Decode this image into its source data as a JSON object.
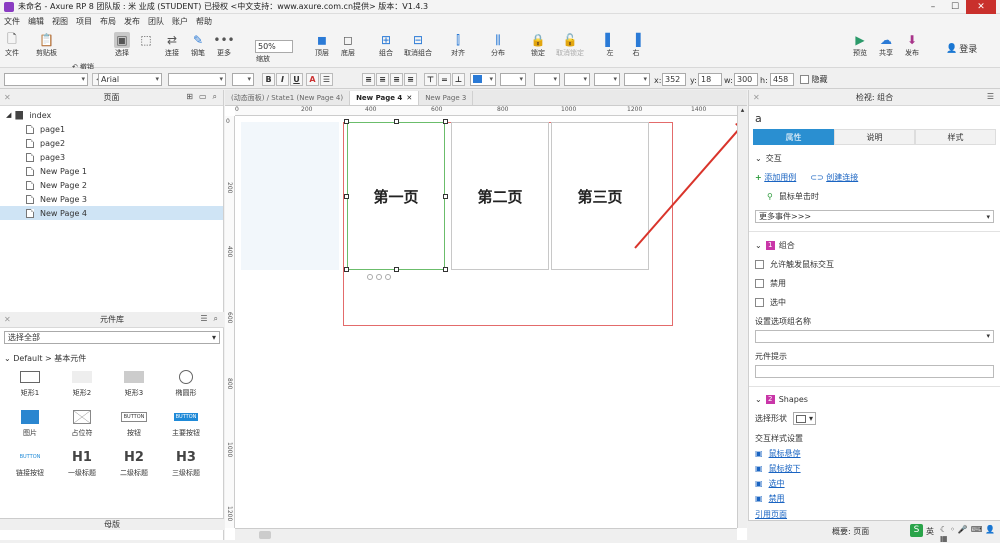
{
  "window": {
    "title": "未命名 - Axure RP 8 团队版 : 米 业成 (STUDENT) 已授权     <中文支持：www.axure.com.cn提供> 版本：V1.4.3"
  },
  "menu": [
    "文件",
    "编辑",
    "视图",
    "项目",
    "布局",
    "发布",
    "团队",
    "账户",
    "帮助"
  ],
  "toolbar": {
    "file": "文件",
    "clipboard": "剪贴板",
    "undo": "撤销",
    "redo": "重做",
    "select": "选择",
    "connect": "连接",
    "pen": "钢笔",
    "more": "更多",
    "zoom_value": "50%",
    "zoom": "缩放",
    "top": "顶层",
    "bottom": "底层",
    "group": "组合",
    "ungroup": "取消组合",
    "align": "对齐",
    "distribute": "分布",
    "lock": "锁定",
    "unlock": "取消锁定",
    "left": "左",
    "right": "右",
    "preview": "预览",
    "share": "共享",
    "publish": "发布",
    "login": "登录"
  },
  "format": {
    "font": "Arial",
    "x_label": "x:",
    "x": "352",
    "y_label": "y:",
    "y": "18",
    "w_label": "w:",
    "w": "300",
    "h_label": "h:",
    "h": "458",
    "hidden": "隐藏"
  },
  "pages_panel": {
    "title": "页面",
    "root": "index",
    "items": [
      "page1",
      "page2",
      "page3",
      "New Page 1",
      "New Page 2",
      "New Page 3",
      "New Page 4"
    ],
    "selected": "New Page 4"
  },
  "library": {
    "title": "元件库",
    "select": "选择全部",
    "group": "Default > 基本元件",
    "widgets": [
      {
        "label": "矩形1",
        "icon": "rect1-icon"
      },
      {
        "label": "矩形2",
        "icon": "rect2-icon"
      },
      {
        "label": "矩形3",
        "icon": "rect3-icon"
      },
      {
        "label": "椭圆形",
        "icon": "ellipse-icon"
      },
      {
        "label": "图片",
        "icon": "image-icon"
      },
      {
        "label": "占位符",
        "icon": "placeholder-icon"
      },
      {
        "label": "按钮",
        "icon": "button-icon"
      },
      {
        "label": "主要按钮",
        "icon": "primary-button-icon"
      },
      {
        "label": "链接按钮",
        "icon": "link-button-icon"
      },
      {
        "label": "一级标题",
        "icon": "h1-icon"
      },
      {
        "label": "二级标题",
        "icon": "h2-icon"
      },
      {
        "label": "三级标题",
        "icon": "h3-icon"
      }
    ],
    "button_text": "BUTTON",
    "h1": "H1",
    "h2": "H2",
    "h3": "H3",
    "masters": "母版"
  },
  "editor": {
    "tabs": [
      "(动态面板) / State1 (New Page 4)",
      "New Page 4",
      "New Page 3"
    ],
    "active_tab": "New Page 4",
    "ruler_h": [
      "0",
      "200",
      "400",
      "600",
      "800",
      "1000",
      "1200",
      "1400"
    ],
    "ruler_v": [
      "0",
      "200",
      "400",
      "600",
      "800",
      "1000",
      "1200"
    ],
    "cards": [
      "第一页",
      "第二页",
      "第三页"
    ]
  },
  "inspector": {
    "title": "检视: 组合",
    "name": "a",
    "tabs": [
      "属性",
      "说明",
      "样式"
    ],
    "active_tab": "属性",
    "interaction": "交互",
    "add_case": "添加用例",
    "create_link": "创建连接",
    "on_click": "鼠标单击时",
    "more_events": "更多事件>>>",
    "group_label": "组合",
    "group_num": "1",
    "allow_trigger": "允许触发鼠标交互",
    "disabled": "禁用",
    "selected": "选中",
    "group_name_label": "设置选项组名称",
    "tooltip_label": "元件提示",
    "shapes_label": "Shapes",
    "shapes_num": "2",
    "select_shape": "选择形状",
    "interaction_styles": "交互样式设置",
    "styles": [
      "鼠标悬停",
      "鼠标按下",
      "选中",
      "禁用"
    ],
    "reference_page": "引用页面"
  },
  "status": {
    "overview": "概要: 页面",
    "ime": "英"
  }
}
